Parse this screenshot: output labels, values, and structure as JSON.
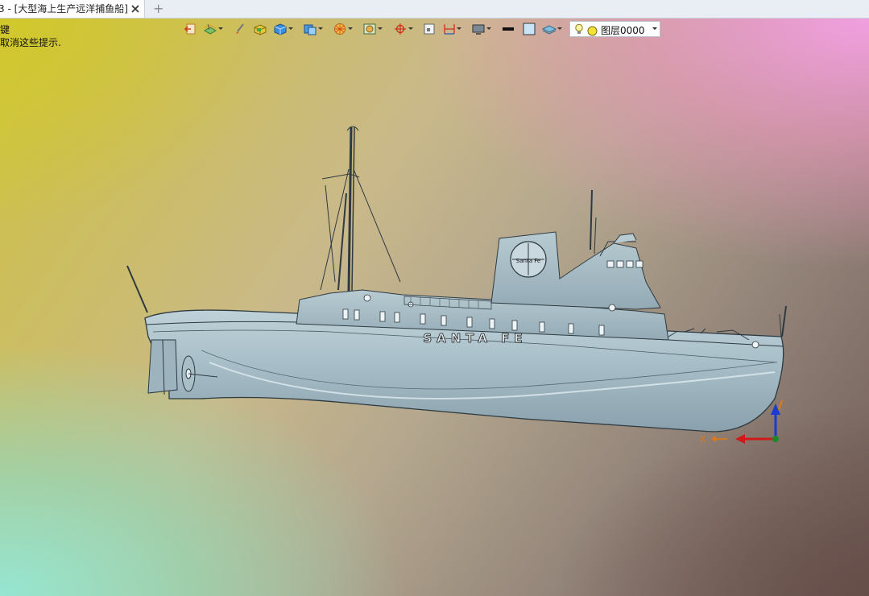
{
  "tab": {
    "title": "3 - [大型海上生产远洋捕鱼船]",
    "new_tab_symbol": "+"
  },
  "hints": {
    "line1": "键",
    "line2": "取消这些提示."
  },
  "toolbar": {
    "icons": [
      "exit-icon",
      "layer-tools-icon",
      "brush-icon",
      "solid-color-icon",
      "box-icon",
      "view-cube-icon",
      "render-sphere-icon",
      "display-mode-icon",
      "snap-target-icon",
      "frame-icon",
      "dimension-icon",
      "monitor-icon",
      "line-style-icon",
      "fill-square-icon",
      "layers-stack-icon"
    ]
  },
  "layer": {
    "name": "图层0000"
  },
  "model": {
    "hull_text": "SANTA FE",
    "stack_text": "Santa Fe"
  },
  "axes": {
    "x_label": "X"
  },
  "colors": {
    "hull": "#a9bfc8",
    "hull_shadow": "#8fa6b2",
    "outline": "#2e3a40",
    "accent": "#1a70c8"
  }
}
